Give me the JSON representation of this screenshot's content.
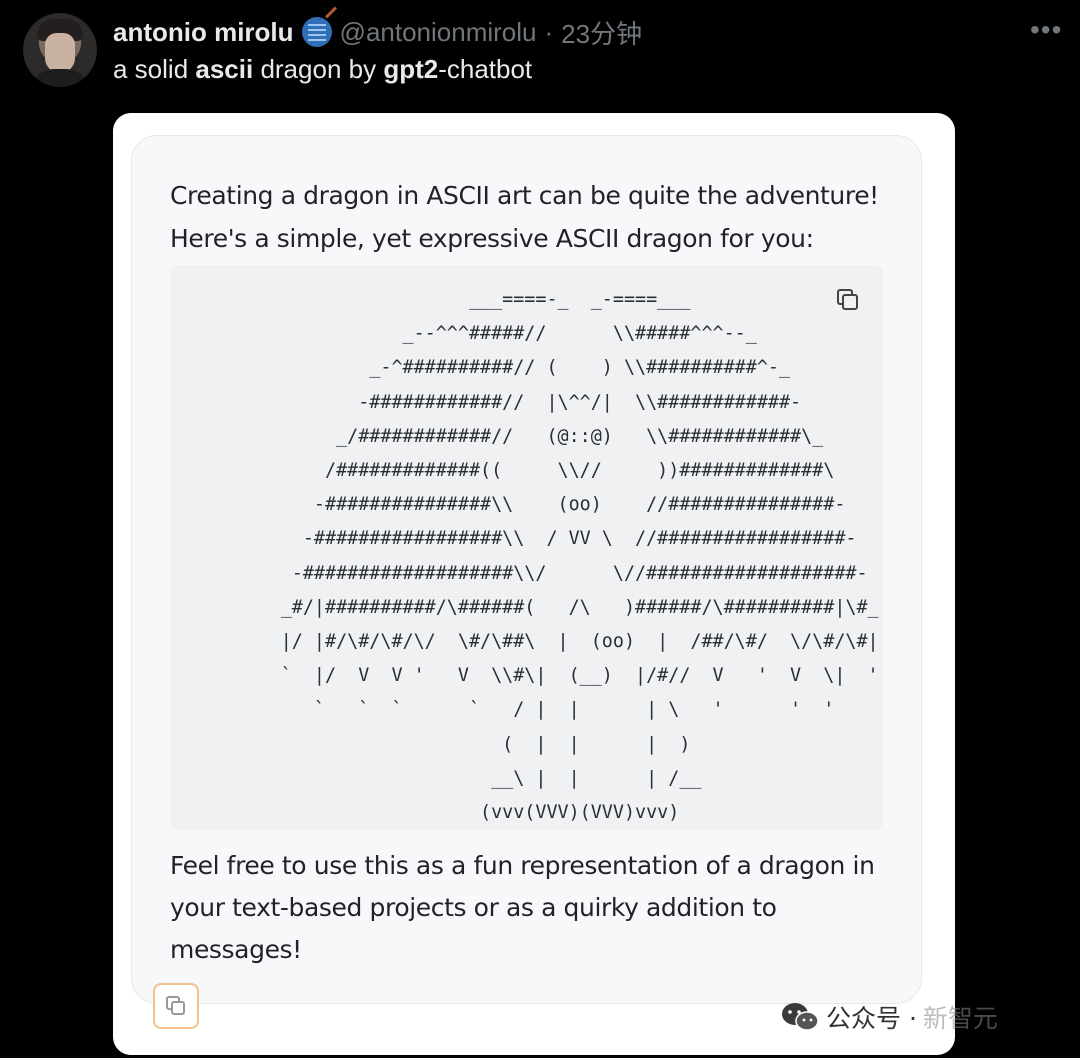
{
  "tweet": {
    "author_name": "antonio mirolu",
    "handle": "@antonionmirolu",
    "separator": "·",
    "time": "23分钟",
    "more_label": "•••",
    "text_parts": [
      "a solid ",
      "ascii",
      " dragon by ",
      "gpt2",
      "-chatbot"
    ]
  },
  "chat": {
    "intro": "Creating a dragon in ASCII art can be quite the adventure! Here's a simple, yet expressive ASCII dragon for you:",
    "ascii_art": "                           ___====-_  _-====___\n                     _--^^^#####//      \\\\#####^^^--_\n                  _-^##########// (    ) \\\\##########^-_\n                 -############//  |\\^^/|  \\\\############-\n               _/############//   (@::@)   \\\\############\\_\n              /#############((     \\\\//     ))#############\\\n             -###############\\\\    (oo)    //###############-\n            -#################\\\\  / VV \\  //#################-\n           -###################\\\\/      \\//###################-\n          _#/|##########/\\######(   /\\   )######/\\##########|\\#_\n          |/ |#/\\#/\\#/\\/  \\#/\\##\\  |  (oo)  |  /##/\\#/  \\/\\#/\\#| \\|\n          `  |/  V  V '   V  \\\\#\\|  (__)  |/#//  V   '  V  \\|  '\n             `   `  `      `   / |  |      | \\   '      '  '\n                              (  |  |      |  )\n                             __\\ |  |      | /__\n                            (vvv(VVV)(VVV)vvv)",
    "outro": "Feel free to use this as a fun representation of a dragon in your text-based projects or as a quirky addition to messages!"
  },
  "watermark": {
    "label": "公众号 ·",
    "name": "新智元"
  },
  "icons": {
    "code_copy": "copy-icon",
    "message_copy": "copy-icon",
    "badge": "yarn-ball-icon",
    "watermark_logo": "wechat-icon"
  },
  "colors": {
    "background": "#000000",
    "muted_text": "#71767b",
    "copy_button_border": "#f2c28c"
  }
}
